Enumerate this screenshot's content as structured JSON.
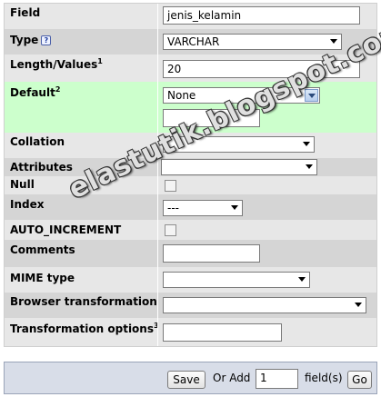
{
  "fields": {
    "field": {
      "label": "Field",
      "value": "jenis_kelamin"
    },
    "type": {
      "label": "Type",
      "value": "VARCHAR",
      "help_icon": "help-icon"
    },
    "length": {
      "label": "Length/Values",
      "sup": "1",
      "value": "20"
    },
    "default": {
      "label": "Default",
      "sup": "2",
      "value": "None",
      "extra_value": ""
    },
    "collation": {
      "label": "Collation",
      "value": ""
    },
    "attributes": {
      "label": "Attributes",
      "value": ""
    },
    "null": {
      "label": "Null",
      "checked": false
    },
    "index": {
      "label": "Index",
      "value": "---"
    },
    "auto_increment": {
      "label": "AUTO_INCREMENT",
      "checked": false
    },
    "comments": {
      "label": "Comments",
      "value": ""
    },
    "mime_type": {
      "label": "MIME type",
      "value": ""
    },
    "browser_transformation": {
      "label": "Browser transformation",
      "value": ""
    },
    "transformation_options": {
      "label": "Transformation options",
      "sup": "3",
      "value": ""
    }
  },
  "footer": {
    "save_label": "Save",
    "or_add_label": "Or Add",
    "add_count": "1",
    "fields_label": "field(s)",
    "go_label": "Go"
  },
  "watermark": "elastutik.blogspot.com",
  "colors": {
    "row_light": "#e7e7e7",
    "row_dark": "#d5d5d5",
    "default_row": "#ccffcc",
    "footer_bg": "#d8dde8"
  }
}
